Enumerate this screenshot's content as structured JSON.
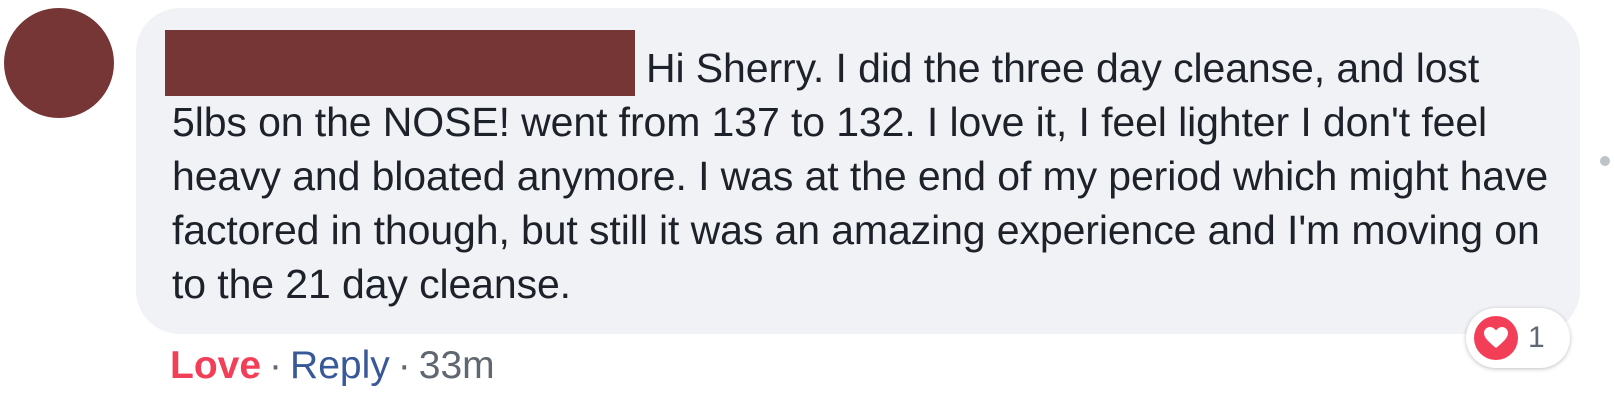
{
  "colors": {
    "avatar": "#773636",
    "redaction": "#773636",
    "bubble_background": "#f1f2f6",
    "love_accent": "#f33e58",
    "link_blue": "#385898",
    "meta_gray": "#606770"
  },
  "comment": {
    "text": "Hi Sherry. I did the three day cleanse, and lost 5lbs on the NOSE! went from 137 to 132. I love it, I feel lighter I don't feel heavy and bloated anymore. I was at the end of my period which might have factored in though, but still it was an amazing experience and I'm moving on to the 21 day cleanse."
  },
  "reactions": {
    "icon": "heart-icon",
    "count": "1"
  },
  "actions": {
    "love_label": "Love",
    "separator": "·",
    "reply_label": "Reply",
    "timestamp": "33m"
  }
}
